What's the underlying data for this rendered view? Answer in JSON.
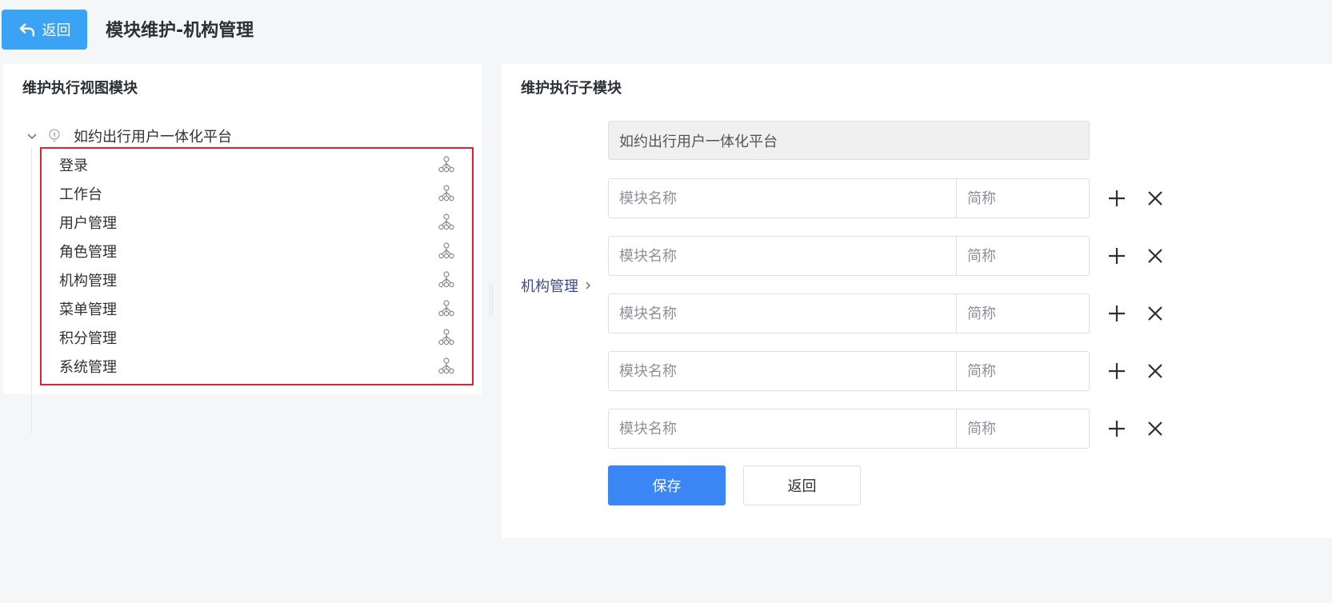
{
  "header": {
    "back_label": "返回",
    "title": "模块维护-机构管理"
  },
  "left_panel": {
    "title": "维护执行视图模块",
    "root_label": "如约出行用户一体化平台",
    "items": [
      {
        "label": "登录"
      },
      {
        "label": "工作台"
      },
      {
        "label": "用户管理"
      },
      {
        "label": "角色管理"
      },
      {
        "label": "机构管理"
      },
      {
        "label": "菜单管理"
      },
      {
        "label": "积分管理"
      },
      {
        "label": "系统管理"
      }
    ]
  },
  "right_panel": {
    "title": "维护执行子模块",
    "current_module": "机构管理",
    "parent_value": "如约出行用户一体化平台",
    "rows": [
      {
        "name_placeholder": "模块名称",
        "abbr_placeholder": "简称"
      },
      {
        "name_placeholder": "模块名称",
        "abbr_placeholder": "简称"
      },
      {
        "name_placeholder": "模块名称",
        "abbr_placeholder": "简称"
      },
      {
        "name_placeholder": "模块名称",
        "abbr_placeholder": "简称"
      },
      {
        "name_placeholder": "模块名称",
        "abbr_placeholder": "简称"
      }
    ],
    "save_label": "保存",
    "return_label": "返回"
  },
  "colors": {
    "back_button": "#3aa3f4",
    "save_button": "#3a86f4",
    "highlight_border": "#d9232e",
    "crumb_text": "#3b4a8c"
  },
  "icons": {
    "back": "return-arrow-icon",
    "tree_expand": "chevron-down-icon",
    "root": "lightbulb-icon",
    "item": "hierarchy-icon",
    "add": "plus-icon",
    "remove": "close-icon",
    "crumb": "chevron-right-icon"
  }
}
